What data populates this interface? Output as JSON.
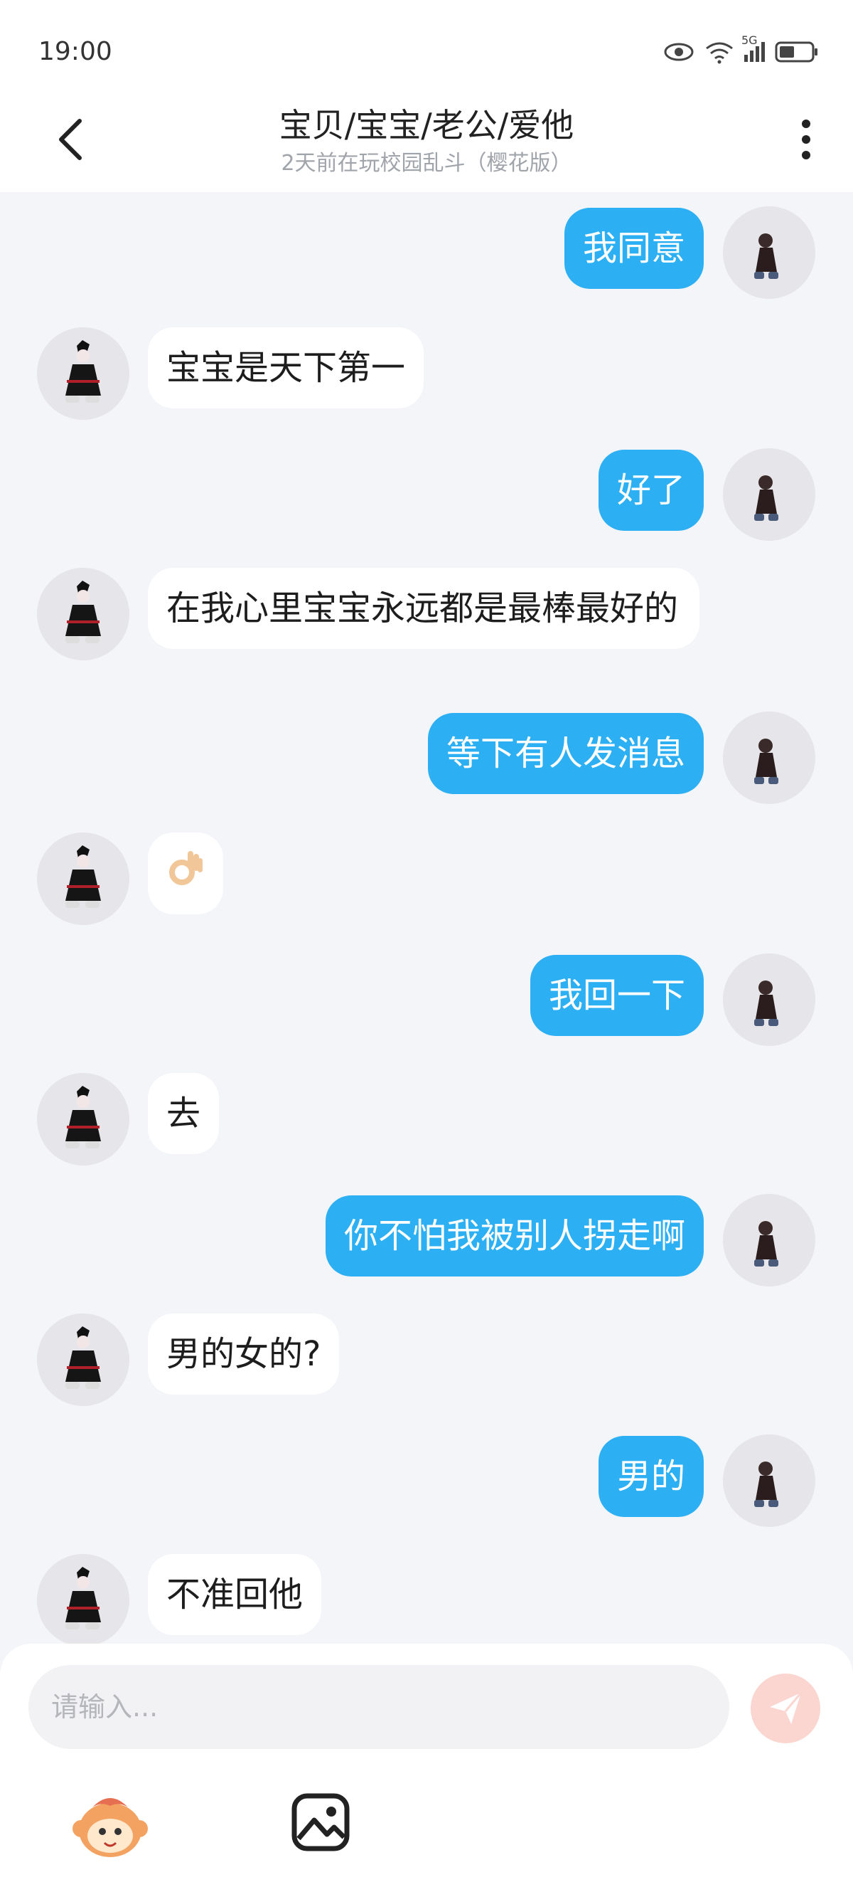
{
  "status_bar": {
    "time": "19:00",
    "icons": [
      "eye-icon",
      "wifi-icon",
      "5g-signal-icon",
      "battery-icon"
    ],
    "network_label": "5G"
  },
  "header": {
    "title": "宝贝/宝宝/老公/爱他",
    "subtitle": "2天前在玩校园乱斗（樱花版）",
    "back_icon": "chevron-left-icon",
    "more_icon": "more-vertical-icon"
  },
  "messages": [
    {
      "side": "right",
      "text": "我同意"
    },
    {
      "side": "left",
      "text": "宝宝是天下第一"
    },
    {
      "side": "right",
      "text": "好了"
    },
    {
      "side": "left",
      "text": "在我心里宝宝永远都是最棒最好的"
    },
    {
      "side": "right",
      "text": "等下有人发消息"
    },
    {
      "side": "left",
      "text": "👌",
      "emoji_name": "ok-hand-emoji"
    },
    {
      "side": "right",
      "text": "我回一下"
    },
    {
      "side": "left",
      "text": "去"
    },
    {
      "side": "right",
      "text": "你不怕我被别人拐走啊"
    },
    {
      "side": "left",
      "text": "男的女的?"
    },
    {
      "side": "right",
      "text": "男的"
    },
    {
      "side": "left",
      "text": "不准回他"
    }
  ],
  "composer": {
    "placeholder": "请输入...",
    "send_icon": "paper-plane-icon",
    "toolbar": [
      "mascot-sticker-icon",
      "image-icon"
    ]
  },
  "colors": {
    "accent": "#2db0f3",
    "background": "#f3f5f9",
    "send_button": "#fbd5d0"
  }
}
